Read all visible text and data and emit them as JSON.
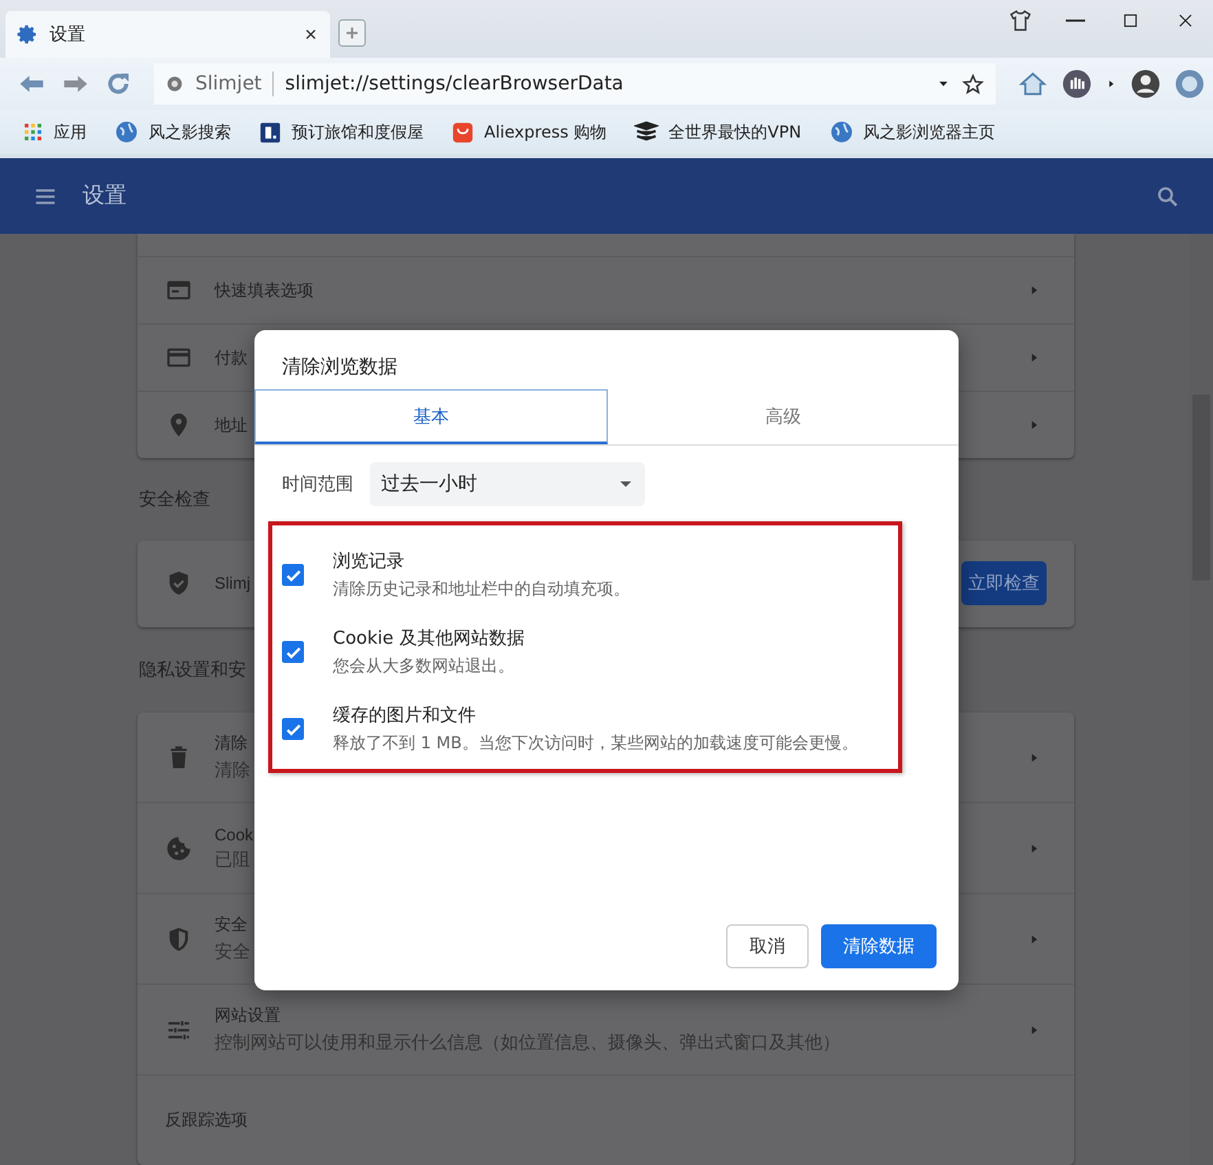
{
  "browser": {
    "tab": {
      "title": "设置"
    },
    "address_bar": {
      "site_label": "Slimjet",
      "url": "slimjet://settings/clearBrowserData"
    },
    "bookmarks": [
      {
        "label": "应用",
        "kind": "apps"
      },
      {
        "label": "风之影搜索",
        "kind": "globe"
      },
      {
        "label": "预订旅馆和度假屋",
        "kind": "booking"
      },
      {
        "label": "Aliexpress 购物",
        "kind": "shop"
      },
      {
        "label": "全世界最快的VPN",
        "kind": "vpn"
      },
      {
        "label": "风之影浏览器主页",
        "kind": "globe"
      }
    ]
  },
  "settings_header": {
    "title": "设置"
  },
  "settings": {
    "sections": [
      {
        "rows": [
          {
            "kind": "autofill",
            "title": "快速填表选项"
          },
          {
            "kind": "payment",
            "title": "付款"
          },
          {
            "kind": "address",
            "title": "地址"
          }
        ]
      },
      {
        "title": "安全检查",
        "rows": [
          {
            "kind": "safety",
            "title": "Slimj",
            "button": "立即检查"
          }
        ]
      },
      {
        "title": "隐私设置和安",
        "rows": [
          {
            "kind": "clear",
            "title": "清除",
            "subtitle": "清除"
          },
          {
            "kind": "cookie",
            "title": "Cook",
            "subtitle": "已阻"
          },
          {
            "kind": "security",
            "title": "安全",
            "subtitle": "安全"
          },
          {
            "kind": "site",
            "title": "网站设置",
            "subtitle": "控制网站可以使用和显示什么信息（如位置信息、摄像头、弹出式窗口及其他）"
          },
          {
            "kind": "plain",
            "title": "反跟踪选项"
          }
        ]
      }
    ]
  },
  "dialog": {
    "title": "清除浏览数据",
    "tabs": [
      {
        "label": "基本",
        "selected": true
      },
      {
        "label": "高级",
        "selected": false
      }
    ],
    "time_range": {
      "label": "时间范围",
      "value": "过去一小时"
    },
    "items": [
      {
        "title": "浏览记录",
        "description": "清除历史记录和地址栏中的自动填充项。",
        "checked": true
      },
      {
        "title": "Cookie 及其他网站数据",
        "description": "您会从大多数网站退出。",
        "checked": true
      },
      {
        "title": "缓存的图片和文件",
        "description": "释放了不到 1 MB。当您下次访问时，某些网站的加载速度可能会更慢。",
        "checked": true
      }
    ],
    "buttons": [
      {
        "label": "取消",
        "kind": "secondary"
      },
      {
        "label": "清除数据",
        "kind": "primary"
      }
    ]
  }
}
